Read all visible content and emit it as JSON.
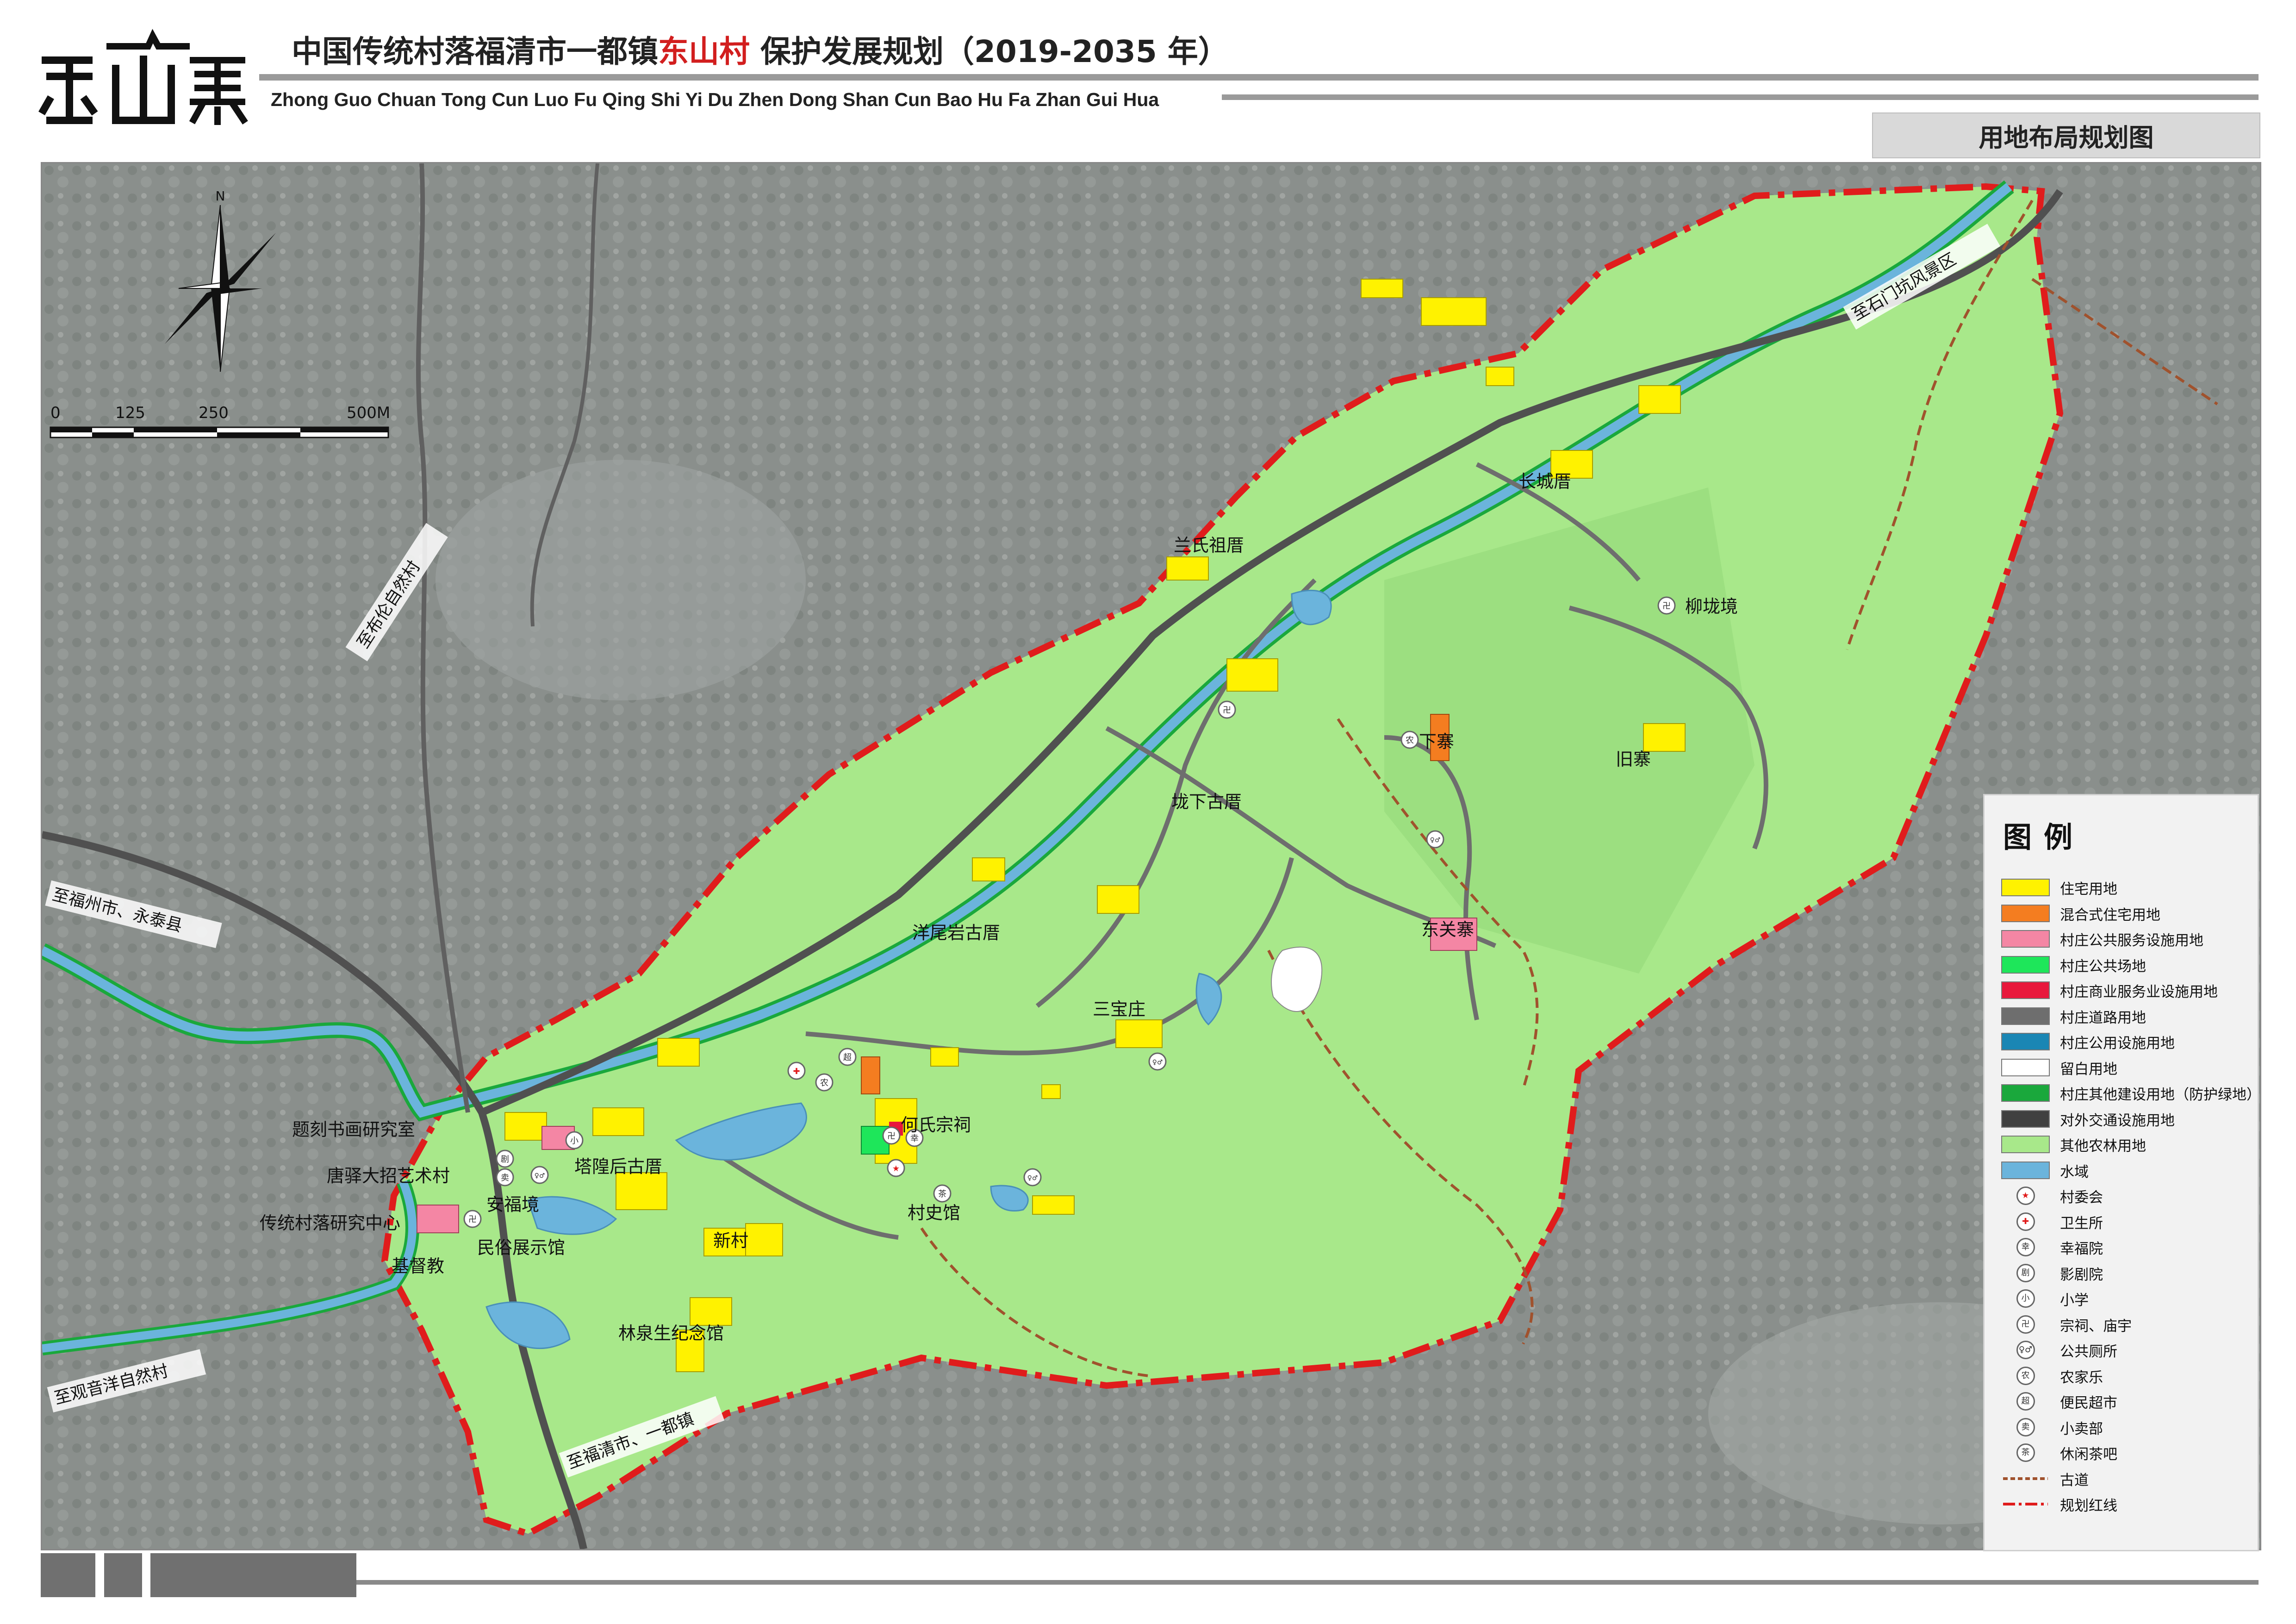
{
  "header": {
    "logo_text": "东山寨",
    "title_prefix": "中国传统村落福清市一都镇",
    "title_highlight": "东山村",
    "title_suffix": " 保护发展规划（2019-2035 年）",
    "pinyin": "Zhong Guo Chuan Tong Cun Luo Fu Qing Shi Yi Du Zhen Dong Shan Cun Bao Hu Fa Zhan Gui Hua",
    "map_title": "用地布局规划图"
  },
  "compass": {
    "north_label": "N"
  },
  "scale_bar": {
    "labels": [
      "0",
      "125",
      "250",
      "500M"
    ]
  },
  "colors": {
    "title_highlight": "#d21e1e",
    "farmland_green": "#a8e88a",
    "residential_yellow": "#fff200",
    "mixed_orange": "#f47d20",
    "public_service_pink": "#f486a4",
    "public_square_green": "#1ee65a",
    "commercial_red": "#e8183c",
    "road_gray": "#6e6e6e",
    "utility_blue": "#1a86b4",
    "reserved_white": "#ffffff",
    "green_buffer": "#1aa83c",
    "transport_dark": "#404040",
    "water_blue": "#6bb4dc",
    "red_line": "#e01c1c",
    "ancient_path": "#a0522d"
  },
  "map": {
    "directions": [
      {
        "id": "to-bulun",
        "text": "至布伦自然村"
      },
      {
        "id": "to-fuzhou",
        "text": "至福州市、永泰县"
      },
      {
        "id": "to-guanyinyang",
        "text": "至观音洋自然村"
      },
      {
        "id": "to-fuqing",
        "text": "至福清市、一都镇"
      },
      {
        "id": "to-shimenkeng",
        "text": "至石门坑风景区"
      }
    ],
    "places": [
      {
        "id": "lanshi",
        "text": "兰氏祖厝"
      },
      {
        "id": "changcheng",
        "text": "长城厝"
      },
      {
        "id": "liulong",
        "text": "柳垅境"
      },
      {
        "id": "xiazhai",
        "text": "下寨"
      },
      {
        "id": "jiuzhai",
        "text": "旧寨"
      },
      {
        "id": "longxia",
        "text": "垅下古厝"
      },
      {
        "id": "yangwei",
        "text": "洋尾岩古厝"
      },
      {
        "id": "dongguan",
        "text": "东关寨"
      },
      {
        "id": "sanbao",
        "text": "三宝庄"
      },
      {
        "id": "heshi",
        "text": "何氏宗祠"
      },
      {
        "id": "cunshi",
        "text": "村史馆"
      },
      {
        "id": "tihuang",
        "text": "塔隍后古厝"
      },
      {
        "id": "tike",
        "text": "题刻书画研究室"
      },
      {
        "id": "tangyi",
        "text": "唐驿大招艺术村"
      },
      {
        "id": "anfu",
        "text": "安福境"
      },
      {
        "id": "chuantong",
        "text": "传统村落研究中心"
      },
      {
        "id": "jidu",
        "text": "基督教"
      },
      {
        "id": "minsu",
        "text": "民俗展示馆"
      },
      {
        "id": "xincun",
        "text": "新村"
      },
      {
        "id": "linquan",
        "text": "林泉生纪念馆"
      }
    ],
    "icon_glyphs": {
      "village_committee": "★",
      "clinic": "✚",
      "welfare": "幸",
      "cinema": "剧",
      "school": "小",
      "temple": "卍",
      "toilet": "♀♂",
      "farmhouse": "农",
      "supermarket": "超",
      "shop": "卖",
      "teahouse": "茶"
    }
  },
  "legend": {
    "title": "图例",
    "items": [
      {
        "label": "住宅用地",
        "kind": "swatch",
        "color": "#fff200"
      },
      {
        "label": "混合式住宅用地",
        "kind": "swatch",
        "color": "#f47d20"
      },
      {
        "label": "村庄公共服务设施用地",
        "kind": "swatch",
        "color": "#f486a4"
      },
      {
        "label": "村庄公共场地",
        "kind": "swatch",
        "color": "#1ee65a"
      },
      {
        "label": "村庄商业服务业设施用地",
        "kind": "swatch",
        "color": "#e8183c"
      },
      {
        "label": "村庄道路用地",
        "kind": "swatch",
        "color": "#6e6e6e"
      },
      {
        "label": "村庄公用设施用地",
        "kind": "swatch",
        "color": "#1a86b4"
      },
      {
        "label": "留白用地",
        "kind": "swatch",
        "color": "#ffffff"
      },
      {
        "label": "村庄其他建设用地（防护绿地）",
        "kind": "swatch",
        "color": "#1aa83c"
      },
      {
        "label": "对外交通设施用地",
        "kind": "swatch",
        "color": "#404040"
      },
      {
        "label": "其他农林用地",
        "kind": "swatch",
        "color": "#a8e88a"
      },
      {
        "label": "水域",
        "kind": "swatch",
        "color": "#6bb4dc"
      },
      {
        "label": "村委会",
        "kind": "icon",
        "glyph": "★",
        "glyph_color": "#e01c1c"
      },
      {
        "label": "卫生所",
        "kind": "icon",
        "glyph": "✚",
        "glyph_color": "#e01c1c"
      },
      {
        "label": "幸福院",
        "kind": "icon",
        "glyph": "幸",
        "glyph_color": "#333333"
      },
      {
        "label": "影剧院",
        "kind": "icon",
        "glyph": "剧",
        "glyph_color": "#333333"
      },
      {
        "label": "小学",
        "kind": "icon",
        "glyph": "小",
        "glyph_color": "#333333"
      },
      {
        "label": "宗祠、庙宇",
        "kind": "icon",
        "glyph": "卍",
        "glyph_color": "#333333"
      },
      {
        "label": "公共厕所",
        "kind": "icon",
        "glyph": "♀♂",
        "glyph_color": "#333333"
      },
      {
        "label": "农家乐",
        "kind": "icon",
        "glyph": "农",
        "glyph_color": "#333333"
      },
      {
        "label": "便民超市",
        "kind": "icon",
        "glyph": "超",
        "glyph_color": "#333333"
      },
      {
        "label": "小卖部",
        "kind": "icon",
        "glyph": "卖",
        "glyph_color": "#333333"
      },
      {
        "label": "休闲茶吧",
        "kind": "icon",
        "glyph": "茶",
        "glyph_color": "#333333"
      },
      {
        "label": "古道",
        "kind": "line",
        "color": "#a0522d",
        "dash": "10,6"
      },
      {
        "label": "规划红线",
        "kind": "line",
        "color": "#e01c1c",
        "dash": "26,8,6,8"
      }
    ]
  }
}
